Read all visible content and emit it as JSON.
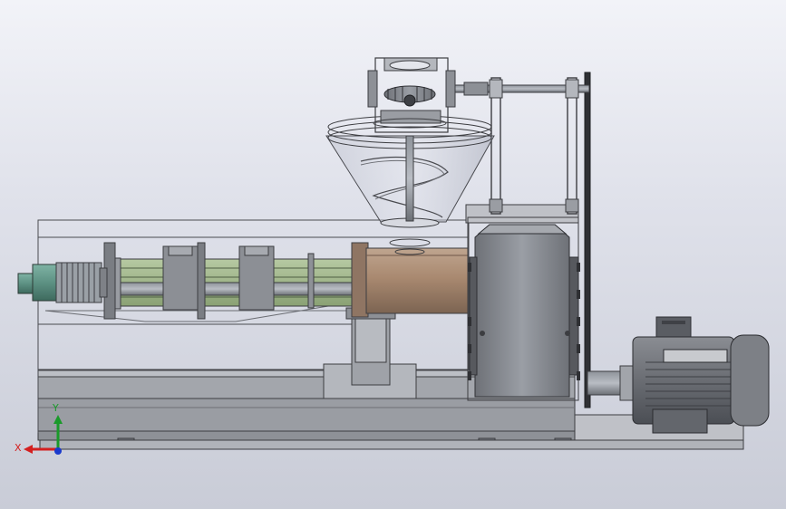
{
  "triad": {
    "x_label": "X",
    "y_label": "Y",
    "x_color": "#d42020",
    "y_color": "#1a9a2a",
    "z_color": "#1a3acc"
  },
  "motor": {
    "nameplate_icon": "motor-nameplate-icon"
  },
  "colors": {
    "steel": "#9da0a6",
    "dark_steel": "#6b6e74",
    "bronze": "#a98970",
    "green_bars": "#9fb58a",
    "teal_nozzle": "#5d9183",
    "hopper_glass": "#c8ccd8"
  }
}
